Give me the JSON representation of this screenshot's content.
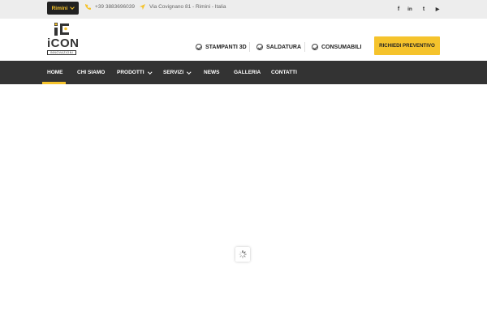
{
  "topbar": {
    "city_label": "Rimini",
    "phone": "+39 3883696039",
    "address": "Via Covignano 81 - Rimini - Italia",
    "social": [
      {
        "name": "facebook",
        "glyph": "f"
      },
      {
        "name": "linkedin",
        "glyph": "in"
      },
      {
        "name": "twitter",
        "glyph": "t"
      },
      {
        "name": "youtube",
        "glyph": "▶"
      }
    ]
  },
  "header": {
    "logo_text": "iCON",
    "logo_subtext": "INNOVAZIONI",
    "links": [
      {
        "label": "STAMPANTI 3D"
      },
      {
        "label": "SALDATURA"
      },
      {
        "label": "CONSUMABILI"
      }
    ],
    "cta_label": "RICHIEDI PREVENTIVO"
  },
  "nav": {
    "items": [
      {
        "label": "HOME",
        "active": true,
        "dropdown": false
      },
      {
        "label": "CHI SIAMO",
        "active": false,
        "dropdown": false
      },
      {
        "label": "PRODOTTI",
        "active": false,
        "dropdown": true
      },
      {
        "label": "SERVIZI",
        "active": false,
        "dropdown": true
      },
      {
        "label": "NEWS",
        "active": false,
        "dropdown": false
      },
      {
        "label": "GALLERIA",
        "active": false,
        "dropdown": false
      },
      {
        "label": "CONTATTI",
        "active": false,
        "dropdown": false
      }
    ]
  },
  "colors": {
    "accent": "#f5c32c",
    "nav_bg": "#333333",
    "topbar_bg": "#ededed"
  }
}
